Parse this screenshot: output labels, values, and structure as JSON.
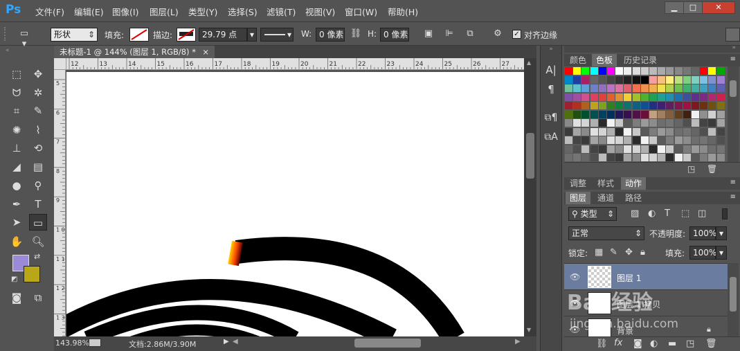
{
  "app": {
    "logo": "Ps"
  },
  "menu": [
    "文件(F)",
    "编辑(E)",
    "图像(I)",
    "图层(L)",
    "类型(Y)",
    "选择(S)",
    "滤镜(T)",
    "视图(V)",
    "窗口(W)",
    "帮助(H)"
  ],
  "window_controls": {
    "minimize": "▁",
    "maximize": "□",
    "close": "✕"
  },
  "options": {
    "mode": "形状",
    "fill_label": "填充:",
    "stroke_label": "描边:",
    "stroke_width": "29.79 点",
    "w_label": "W:",
    "w_value": "0 像素",
    "h_label": "H:",
    "h_value": "0 像素",
    "align_edges_label": "对齐边缘",
    "align_edges_checked": true
  },
  "document": {
    "tab_title": "未标题-1 @ 144% (图层 1, RGB/8) *",
    "close": "×"
  },
  "ruler": {
    "top": [
      "12",
      "13",
      "14",
      "15",
      "16",
      "17",
      "18",
      "19",
      "20",
      "21",
      "22",
      "23",
      "24",
      "25",
      "26",
      "27"
    ],
    "left": [
      "5",
      "6",
      "7",
      "8",
      "9",
      "1 0",
      "1 1",
      "1 2",
      "1 3"
    ]
  },
  "status": {
    "zoom": "143.98%",
    "doc_info": "文档:2.86M/3.90M"
  },
  "colors": {
    "foreground": "#9a8ad8",
    "background": "#b8a818",
    "accent_layer": "#6a7ca0"
  },
  "panels": {
    "top_tabs": [
      "颜色",
      "色板",
      "历史记录"
    ],
    "top_active": "色板",
    "mid_tabs": [
      "调整",
      "样式",
      "动作"
    ],
    "mid_active": "动作",
    "layer_tabs": [
      "图层",
      "通道",
      "路径"
    ],
    "layer_active": "图层",
    "filter_type": "类型",
    "blend_mode": "正常",
    "opacity_label": "不透明度:",
    "opacity_value": "100%",
    "lock_label": "锁定:",
    "fill_label": "填充:",
    "fill_value": "100%"
  },
  "layers": [
    {
      "name": "图层 1",
      "selected": true,
      "visible": true
    },
    {
      "name": "图层 1 拷贝",
      "selected": false,
      "visible": true
    },
    {
      "name": "背景",
      "selected": false,
      "visible": true,
      "locked": true
    }
  ],
  "watermark": {
    "brand": "Bai 经验",
    "url": "jingyan.baidu.com"
  }
}
